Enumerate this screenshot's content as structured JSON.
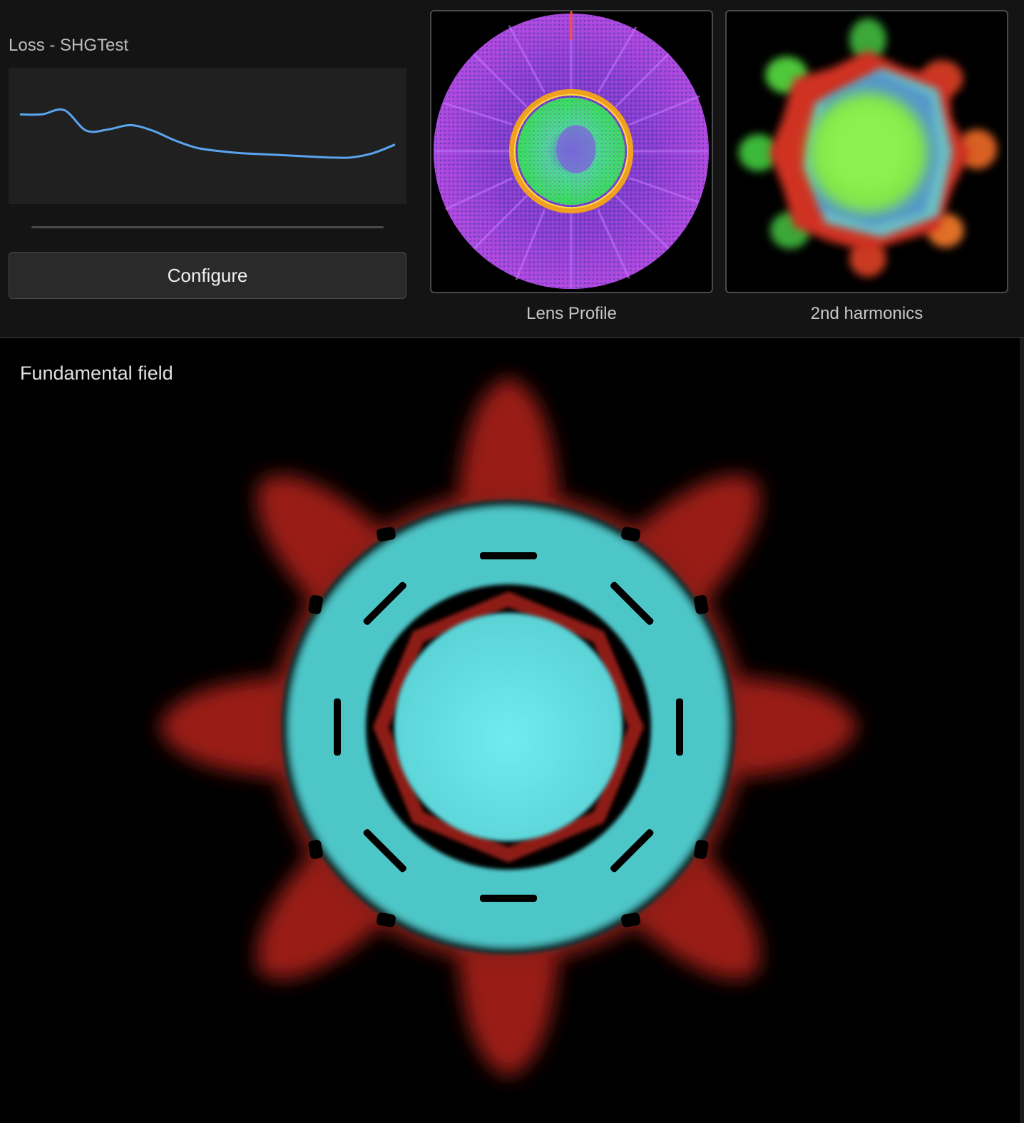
{
  "loss_panel": {
    "title": "Loss - SHGTest",
    "configure_label": "Configure",
    "line_color": "#5aa5f0"
  },
  "chart_data": {
    "type": "line",
    "title": "Loss - SHGTest",
    "xlabel": "",
    "ylabel": "",
    "grid": false,
    "series": [
      {
        "values": [
          0.7,
          0.7,
          0.74,
          0.55,
          0.56,
          0.6,
          0.55,
          0.46,
          0.39,
          0.36,
          0.34,
          0.33,
          0.32,
          0.31,
          0.3,
          0.3,
          0.34,
          0.42
        ]
      }
    ],
    "ylim": [
      0,
      1
    ]
  },
  "lens_profile": {
    "caption": "Lens Profile"
  },
  "second_harmonics": {
    "caption": "2nd harmonics"
  },
  "fundamental_field": {
    "title": "Fundamental field"
  },
  "colors": {
    "field_cyan": "#6de6ea",
    "field_red": "#9a1e16",
    "harmonic_green": "#7fe84a",
    "lens_purple": "#8a3fd0"
  }
}
